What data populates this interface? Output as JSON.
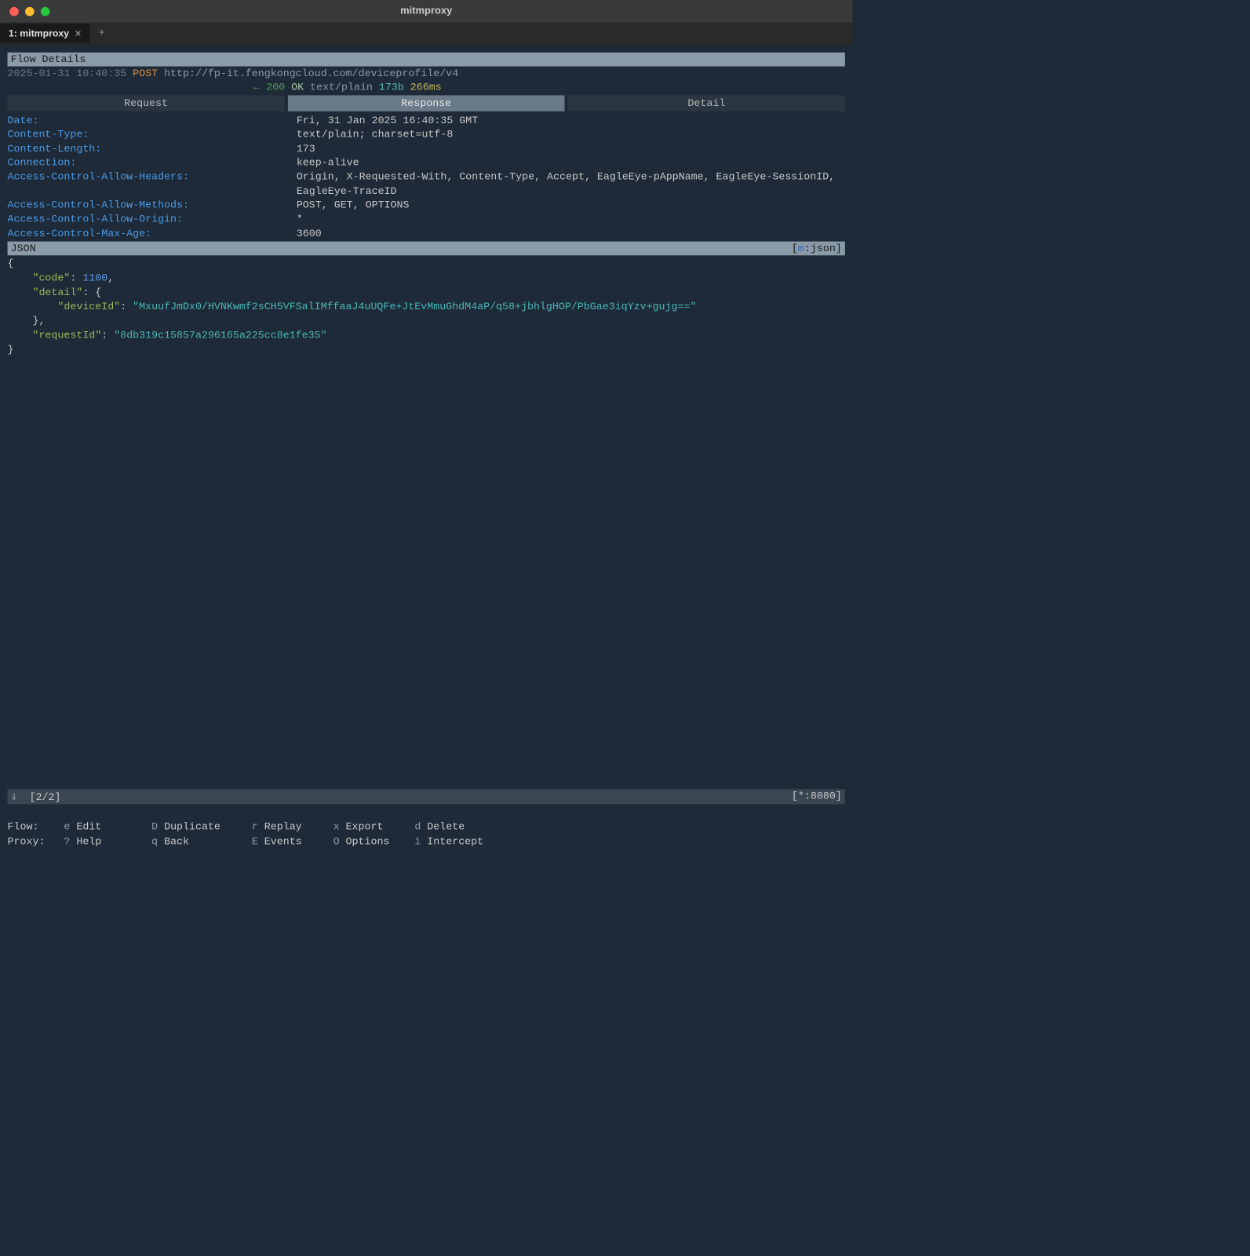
{
  "window": {
    "title": "mitmproxy",
    "tab_label": "1: mitmproxy"
  },
  "section": {
    "title": "Flow Details"
  },
  "request": {
    "timestamp": "2025-01-31 10:40:35",
    "method": "POST",
    "url": "http://fp-it.fengkongcloud.com/deviceprofile/v4"
  },
  "response": {
    "arrow": "←",
    "status_code": "200",
    "status_text": "OK",
    "content_type": "text/plain",
    "size": "173b",
    "time": "266ms"
  },
  "detail_tabs": {
    "request": "Request",
    "response": "Response",
    "detail": "Detail"
  },
  "headers": [
    {
      "key": "Date:",
      "value": "Fri, 31 Jan 2025 16:40:35 GMT"
    },
    {
      "key": "Content-Type:",
      "value": "text/plain; charset=utf-8"
    },
    {
      "key": "Content-Length:",
      "value": "173"
    },
    {
      "key": "Connection:",
      "value": "keep-alive"
    },
    {
      "key": "Access-Control-Allow-Headers:",
      "value": "Origin, X-Requested-With, Content-Type, Accept, EagleEye-pAppName, EagleEye-SessionID, EagleEye-TraceID"
    },
    {
      "key": "Access-Control-Allow-Methods:",
      "value": "POST, GET, OPTIONS"
    },
    {
      "key": "Access-Control-Allow-Origin:",
      "value": "*"
    },
    {
      "key": "Access-Control-Max-Age:",
      "value": "3600"
    }
  ],
  "body_section": {
    "label": "JSON",
    "mode_key": "m",
    "mode_value": ":json"
  },
  "body": {
    "code_key": "\"code\"",
    "code_value": "1100",
    "detail_key": "\"detail\"",
    "deviceId_key": "\"deviceId\"",
    "deviceId_value": "\"MxuufJmDx0/HVNKwmf2sCH5VFSalIMffaaJ4uUQFe+JtEvMmuGhdM4aP/q58+jbhlgHOP/PbGae3iqYzv+gujg==\"",
    "requestId_key": "\"requestId\"",
    "requestId_value": "\"8db319c15857a296165a225cc8e1fe35\""
  },
  "status_bar": {
    "arrow": "⇩",
    "position": "[2/2]",
    "listen": "[*:8080]"
  },
  "help": {
    "flow_label": "Flow:",
    "proxy_label": "Proxy:",
    "flow": [
      {
        "key": "e",
        "label": "Edit"
      },
      {
        "key": "D",
        "label": "Duplicate"
      },
      {
        "key": "r",
        "label": "Replay"
      },
      {
        "key": "x",
        "label": "Export"
      },
      {
        "key": "d",
        "label": "Delete"
      }
    ],
    "proxy": [
      {
        "key": "?",
        "label": "Help"
      },
      {
        "key": "q",
        "label": "Back"
      },
      {
        "key": "E",
        "label": "Events"
      },
      {
        "key": "O",
        "label": "Options"
      },
      {
        "key": "i",
        "label": "Intercept"
      }
    ]
  }
}
